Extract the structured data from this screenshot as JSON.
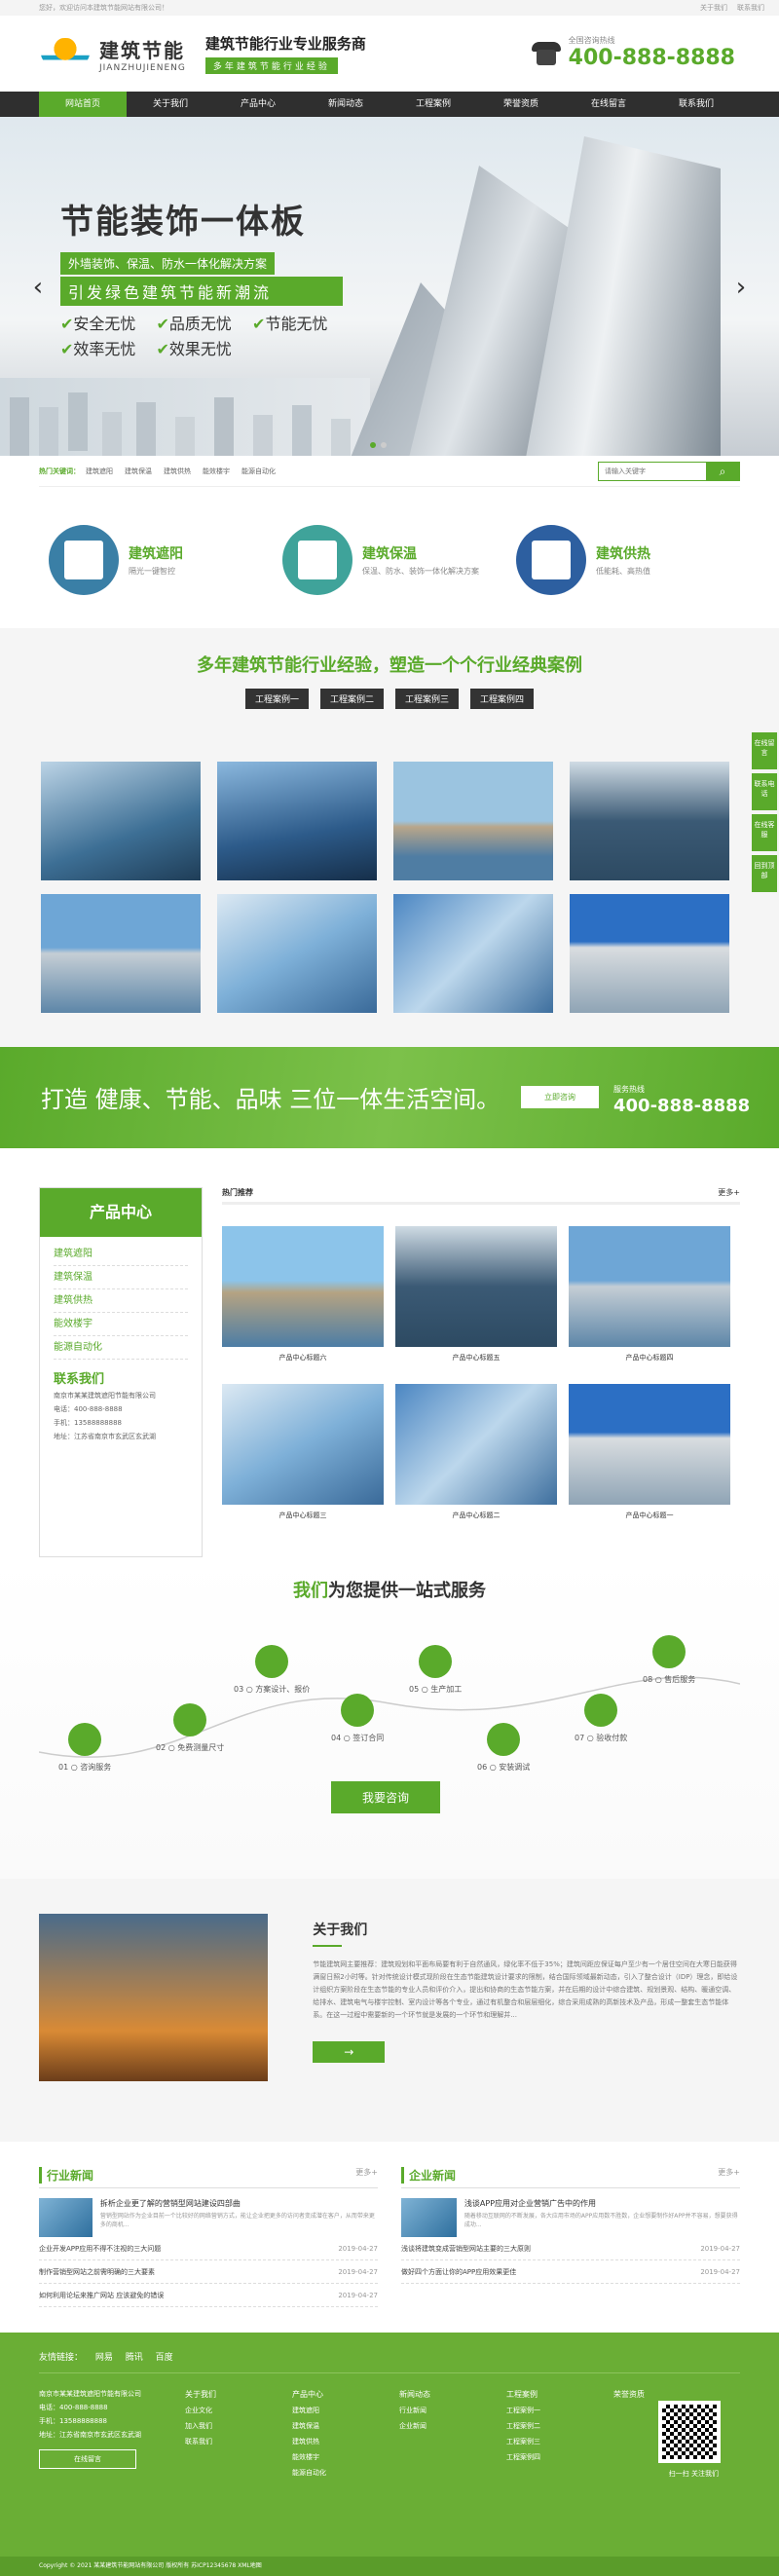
{
  "topbar": {
    "welcome": "您好，欢迎访问本建筑节能网站有限公司！",
    "links": [
      "关于我们",
      "联系我们"
    ]
  },
  "header": {
    "logo_cn": "建筑节能",
    "logo_en": "JIANZHUJIENENG",
    "slogan_title": "建筑节能行业专业服务商",
    "slogan_sub": "多年建筑节能行业经验",
    "hotline_label": "全国咨询热线",
    "hotline_number": "400-888-8888"
  },
  "nav": [
    "网站首页",
    "关于我们",
    "产品中心",
    "新闻动态",
    "工程案例",
    "荣誉资质",
    "在线留言",
    "联系我们"
  ],
  "banner": {
    "title": "节能装饰一体板",
    "line1": "外墙装饰、保温、防水一体化解决方案",
    "line2": "引发绿色建筑节能新潮流",
    "features": [
      "安全无忧",
      "品质无忧",
      "节能无忧",
      "效率无忧",
      "效果无忧"
    ]
  },
  "search": {
    "hot_label": "热门关键词：",
    "keywords": [
      "建筑遮阳",
      "建筑保温",
      "建筑供热",
      "能效楼宇",
      "能源自动化"
    ],
    "placeholder": "请输入关键字"
  },
  "categories": [
    {
      "title": "建筑遮阳",
      "desc": "隔光一键智控",
      "icon": "shutter-icon",
      "color": "#3a7fa6"
    },
    {
      "title": "建筑保温",
      "desc": "保温、防水、装饰一体化解决方案",
      "icon": "brick-wall-icon",
      "color": "#3fa39a"
    },
    {
      "title": "建筑供热",
      "desc": "低能耗、高热值",
      "icon": "solar-panel-icon",
      "color": "#2d5fa0"
    }
  ],
  "cases": {
    "heading": "多年建筑节能行业经验，塑造一个个行业经典案例",
    "tabs": [
      "工程案例一",
      "工程案例二",
      "工程案例三",
      "工程案例四"
    ]
  },
  "banner2": {
    "text": "打造 健康、节能、品味 三位一体生活空间。",
    "button": "立即咨询",
    "phone_label": "服务热线",
    "phone": "400-888-8888"
  },
  "sidebar": {
    "title": "产品中心",
    "items": [
      "建筑遮阳",
      "建筑保温",
      "建筑供热",
      "能效楼宇",
      "能源自动化"
    ],
    "contact_title": "联系我们",
    "contact_lines": [
      "南京市某某建筑遮阳节能有限公司",
      "电话：400-888-8888",
      "手机：13588888888",
      "地址：江苏省南京市玄武区玄武湖"
    ]
  },
  "products": {
    "heading": "热门推荐",
    "more": "更多+",
    "items": [
      "产品中心标题六",
      "产品中心标题五",
      "产品中心标题四",
      "产品中心标题三",
      "产品中心标题二",
      "产品中心标题一"
    ]
  },
  "float": [
    "在线留言",
    "联系电话",
    "在线客服",
    "回到顶部"
  ],
  "service": {
    "heading_green": "我们",
    "heading_rest": "为您提供一站式服务",
    "steps": [
      "01 ○ 咨询服务",
      "02 ○ 免费测量尺寸",
      "03 ○ 方案设计、报价",
      "04 ○ 签订合同",
      "05 ○ 生产加工",
      "06 ○ 安装调试",
      "07 ○ 验收付款",
      "08 ○ 售后服务"
    ],
    "button": "我要咨询"
  },
  "about": {
    "title": "关于我们",
    "text": "节能建筑网主要推荐：建筑规划和平面布局要有利于自然通风，绿化率不低于35%；建筑间距应保证每户至少有一个居住空间在大寒日能获得满窗日照2小时等。针对传统设计模式现阶段在生态节能建筑设计要求的限制，结合国际领域最新动态，引入了整合设计（IDP）理念，即给设计组织方案阶段在生态节能的专业人员和评价介入，提出和协商的生态节能方案，并在后期的设计中综合建筑、规划景观、结构、暖通空调、给排水、建筑电气与楼宇控制、室内设计等各个专业，通过有机整合和层层细化，综合采用成熟的高新技术及产品，形成一整套生态节能体系。在这一过程中需要新的一个环节就是发展的一个环节和理解并..."
  },
  "news": {
    "industry": {
      "title": "行业新闻",
      "more": "更多+",
      "top_title": "拆析企业更了解的营销型网站建设四部曲",
      "top_desc": "营销型网站作为企业目前一个比较好的网络营销方式，能让企业把更多的访问者变成潜在客户，从而带来更多的商机...",
      "rows": [
        {
          "t": "企业开发APP应用不得不注视的三大问题",
          "d": "2019-04-27"
        },
        {
          "t": "制作营销型网站之前需明确的三大要素",
          "d": "2019-04-27"
        },
        {
          "t": "如何利用论坛来推广网站 应该避免的错误",
          "d": "2019-04-27"
        }
      ]
    },
    "company": {
      "title": "企业新闻",
      "more": "更多+",
      "top_title": "浅谈APP应用对企业营销广告中的作用",
      "top_desc": "随着移动互联网的不断发展，各大应用市场的APP应用数不胜数，企业想要制作好APP并不容易，想要获得成功...",
      "rows": [
        {
          "t": "浅谈将建筑变成营销型网站主要的三大原则",
          "d": "2019-04-27"
        },
        {
          "t": "做好四个方面让你的APP应用效果更佳",
          "d": "2019-04-27"
        }
      ]
    }
  },
  "footer": {
    "links_label": "友情链接：",
    "links": [
      "网易",
      "腾讯",
      "百度"
    ],
    "company": "南京市某某建筑遮阳节能有限公司",
    "contact": [
      "电话：400-888-8888",
      "手机：13588888888",
      "地址：江苏省南京市玄武区玄武湖"
    ],
    "online_btn": "在线留言",
    "columns": [
      {
        "title": "关于我们",
        "items": [
          "企业文化",
          "加入我们",
          "联系我们"
        ]
      },
      {
        "title": "产品中心",
        "items": [
          "建筑遮阳",
          "建筑保温",
          "建筑供热",
          "能效楼宇",
          "能源自动化"
        ]
      },
      {
        "title": "新闻动态",
        "items": [
          "行业新闻",
          "企业新闻"
        ]
      },
      {
        "title": "工程案例",
        "items": [
          "工程案例一",
          "工程案例二",
          "工程案例三",
          "工程案例四"
        ]
      },
      {
        "title": "荣誉资质",
        "items": []
      }
    ],
    "qr_label": "扫一扫 关注我们",
    "copyright": "Copyright © 2021 某某建筑节能网站有限公司 版权所有  苏ICP12345678  XML地图"
  }
}
